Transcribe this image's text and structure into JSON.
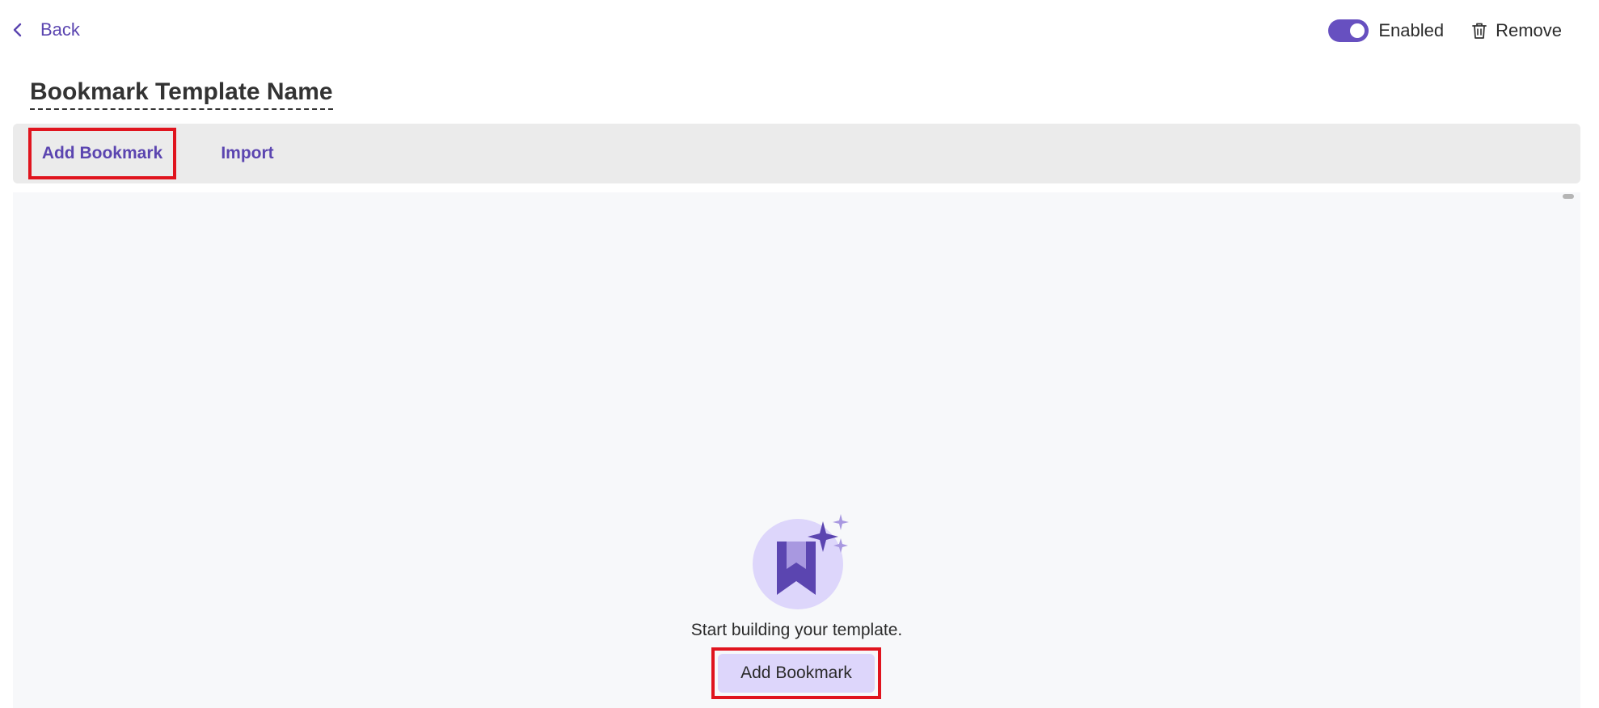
{
  "header": {
    "back_label": "Back",
    "enabled_label": "Enabled",
    "enabled_state": true,
    "remove_label": "Remove"
  },
  "page": {
    "title": "Bookmark Template Name"
  },
  "toolbar": {
    "add_bookmark_label": "Add Bookmark",
    "import_label": "Import"
  },
  "empty_state": {
    "message": "Start building your template.",
    "cta_label": "Add Bookmark",
    "icon": "bookmark-sparkle-icon"
  },
  "colors": {
    "accent": "#6750c0",
    "link": "#5b45b0",
    "cta_background": "#ddd6fb",
    "highlight_border": "#e0141e",
    "toolbar_background": "#ebebeb",
    "canvas_background": "#f7f8fa"
  }
}
